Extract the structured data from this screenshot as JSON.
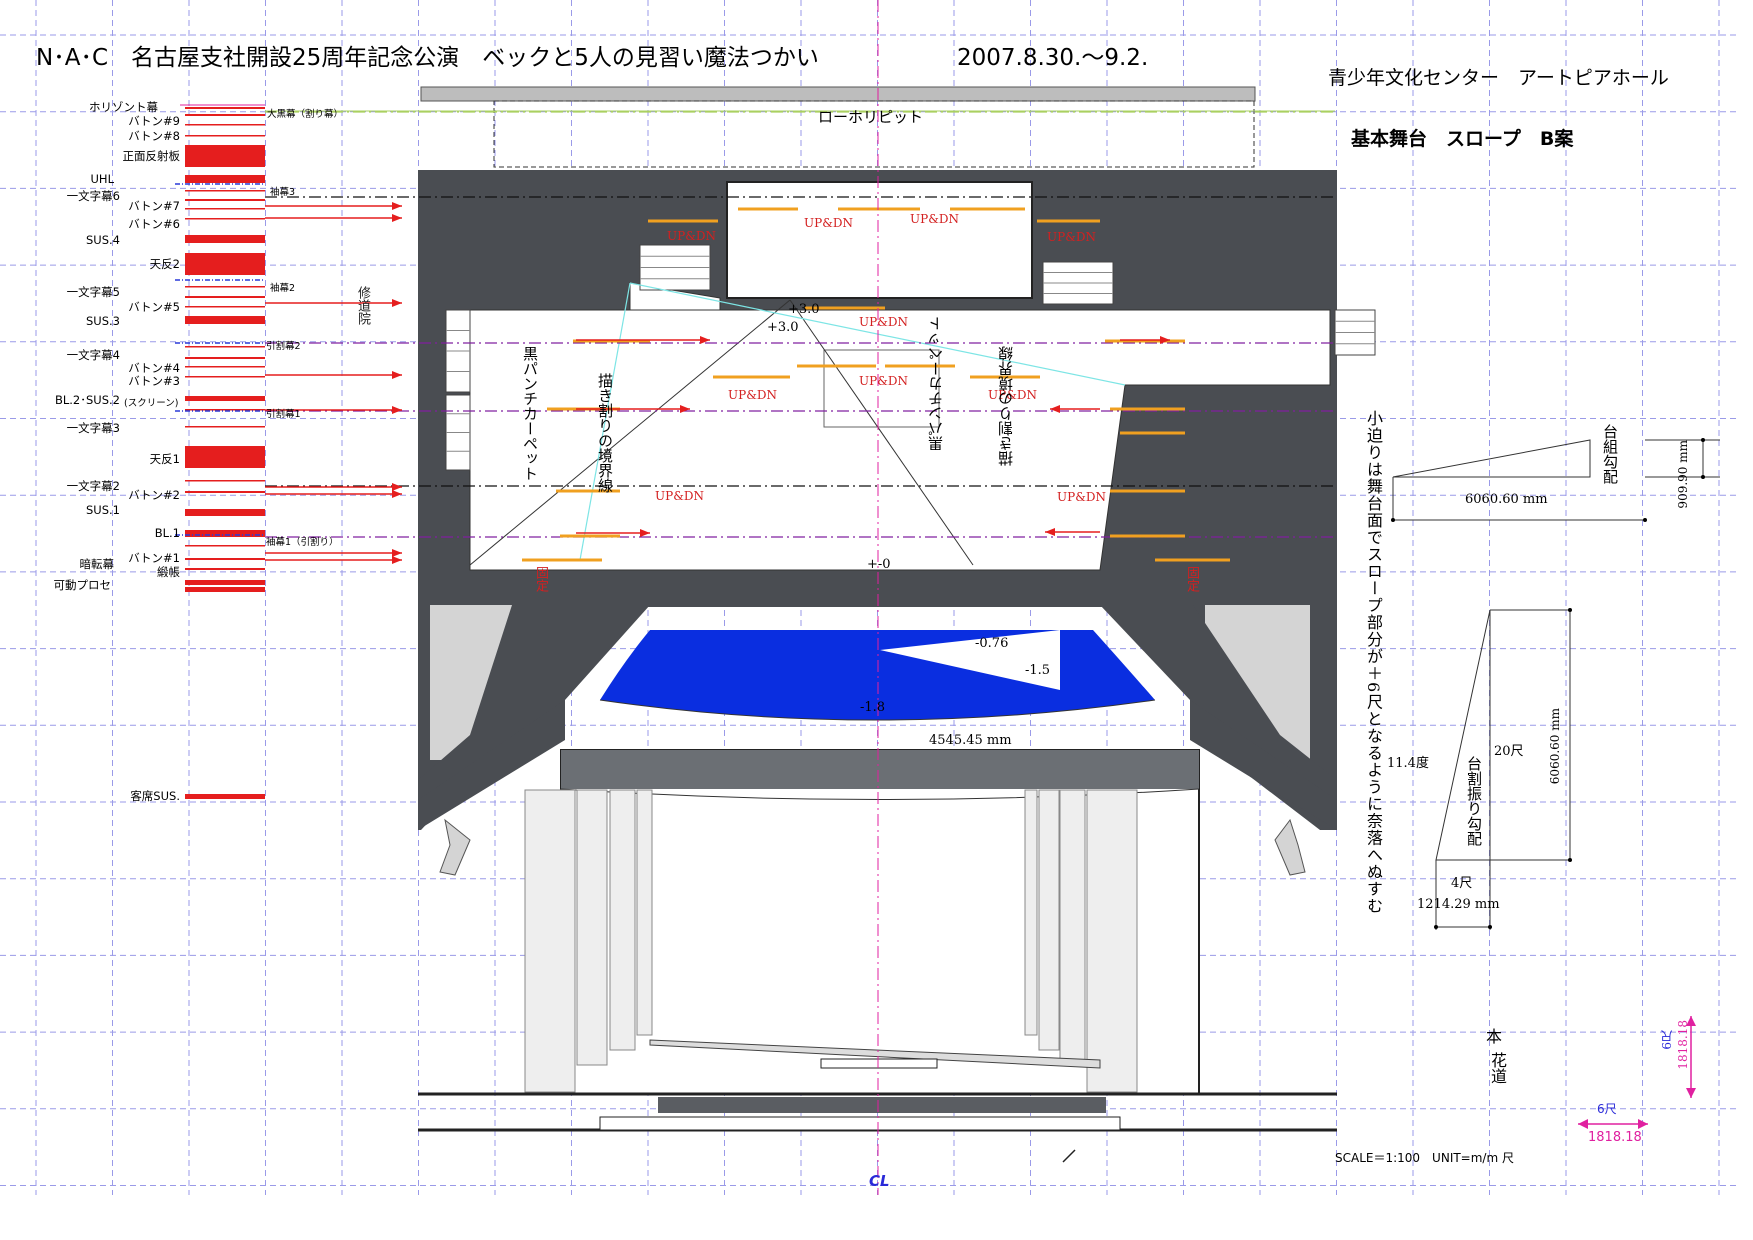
{
  "header": {
    "title": "N･A･C　名古屋支社開設25周年記念公演　ベックと5人の見習い魔法つかい",
    "date": "2007.8.30.〜9.2.",
    "venue": "青少年文化センター　アートピアホール",
    "plan_name": "基本舞台　スロープ　B案"
  },
  "rigging": {
    "horizon": "ホリゾント幕",
    "b9": "バトン#9",
    "b9_note": "大黒幕（割り幕）",
    "b8": "バトン#8",
    "reflector": "正面反射板",
    "uhl": "UHL",
    "ichi6": "一文字幕6",
    "sode3": "袖幕3",
    "b7": "バトン#7",
    "b6": "バトン#6",
    "sus4": "SUS.4",
    "tenhan2": "天反2",
    "sode2": "袖幕2",
    "ichi5": "一文字幕5",
    "b5": "バトン#5",
    "sus3": "SUS.3",
    "hikiwari2": "引割幕2",
    "ichi4": "一文字幕4",
    "b4": "バトン#4",
    "b3": "バトン#3",
    "bl2": "BL.2･SUS.2",
    "screen": "(スクリーン)",
    "hikiwari1": "引割幕1",
    "ichi3": "一文字幕3",
    "tenhan1": "天反1",
    "ichi2": "一文字幕2",
    "b2": "バトン#2",
    "sus1": "SUS.1",
    "bl1": "BL.1",
    "sode1": "袖幕1（引割り）",
    "anten": "暗転幕",
    "b1": "バトン#1",
    "kanecho": "緞帳",
    "prose": "可動プロセ",
    "kyaku": "客席SUS."
  },
  "stage": {
    "low_horizon_pit": "ローホリピット",
    "updn": "UP&DN",
    "shudouin": "修道院",
    "plus3": "+3.0",
    "zero": "+-0",
    "minus076": "-0.76",
    "minus15": "-1.5",
    "minus18": "-1.8",
    "width_mm": "4545.45 mm",
    "black_carpet": "黒パンチカーペット",
    "paint_border": "描き割りの境界線",
    "fixed": "固定",
    "cl": "CL"
  },
  "side": {
    "note": "小迫りは舞台面でスロープ部分が＋6尺となるように奈落へぬすむ",
    "daigumi": "台組勾配",
    "h_mm": "909.90 mm",
    "w_mm": "6060.60 mm",
    "daiwari": "台割振り勾配",
    "angle": "11.4度",
    "shaku20": "20尺",
    "len_mm": "6060.60 mm",
    "shaku4": "4尺",
    "short_mm": "1214.29 mm",
    "hon": "本",
    "hana": "花道",
    "shaku6a": "6尺",
    "mm1818a": "1818.18",
    "shaku6b": "6尺",
    "mm1818b": "1818.18",
    "scale": "SCALE＝1:100　UNIT=m/m 尺"
  },
  "colors": {
    "grid": "#9a9ae8",
    "dark": "#4a4d52",
    "red": "#e51e1e",
    "orange": "#f0a020",
    "blue": "#0a2ee0",
    "magenta": "#e0209c"
  }
}
